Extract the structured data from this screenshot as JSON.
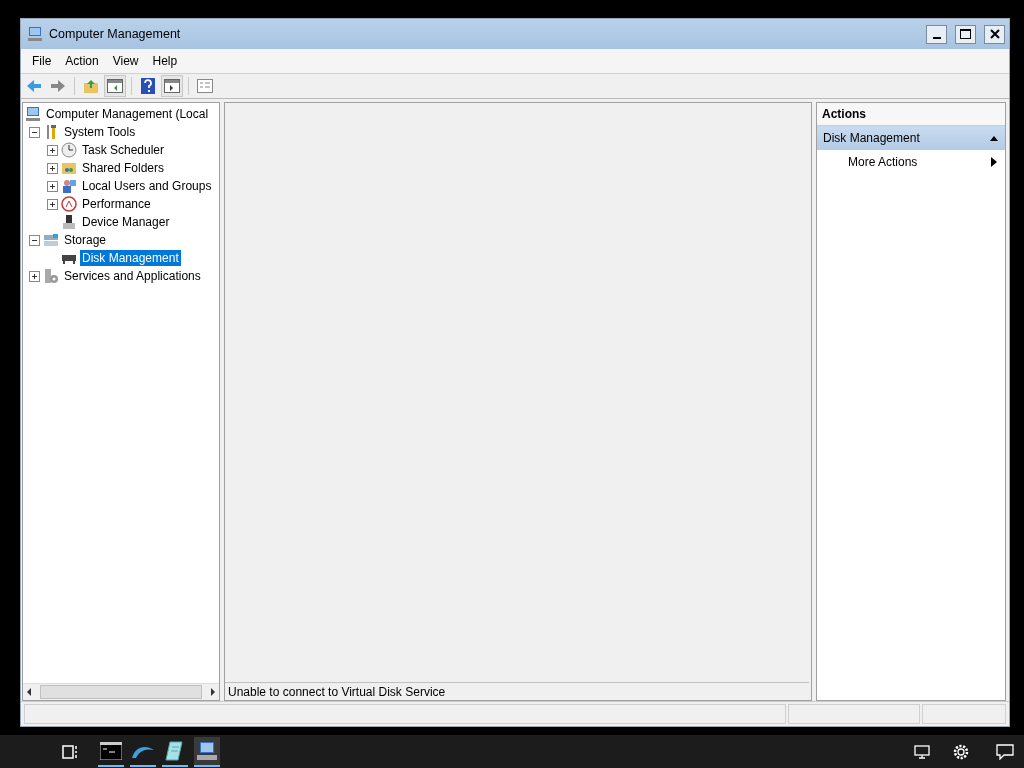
{
  "window": {
    "title": "Computer Management"
  },
  "menu": [
    "File",
    "Action",
    "View",
    "Help"
  ],
  "tree": [
    {
      "label": "Computer Management (Local",
      "selected": false,
      "children": [
        {
          "label": "System Tools",
          "expanded": true,
          "selected": false,
          "children": [
            {
              "label": "Task Scheduler",
              "expanded": false,
              "selected": false
            },
            {
              "label": "Shared Folders",
              "expanded": false,
              "selected": false
            },
            {
              "label": "Local Users and Groups",
              "expanded": false,
              "selected": false
            },
            {
              "label": "Performance",
              "expanded": false,
              "selected": false
            },
            {
              "label": "Device Manager",
              "selected": false
            }
          ]
        },
        {
          "label": "Storage",
          "expanded": true,
          "selected": false,
          "children": [
            {
              "label": "Disk Management",
              "selected": true
            }
          ]
        },
        {
          "label": "Services and Applications",
          "expanded": false,
          "selected": false
        }
      ]
    }
  ],
  "status_message": "Unable to connect to Virtual Disk Service",
  "actions": {
    "title": "Actions",
    "section": {
      "label": "Disk Management",
      "expanded": true
    },
    "items": [
      "More Actions"
    ]
  }
}
